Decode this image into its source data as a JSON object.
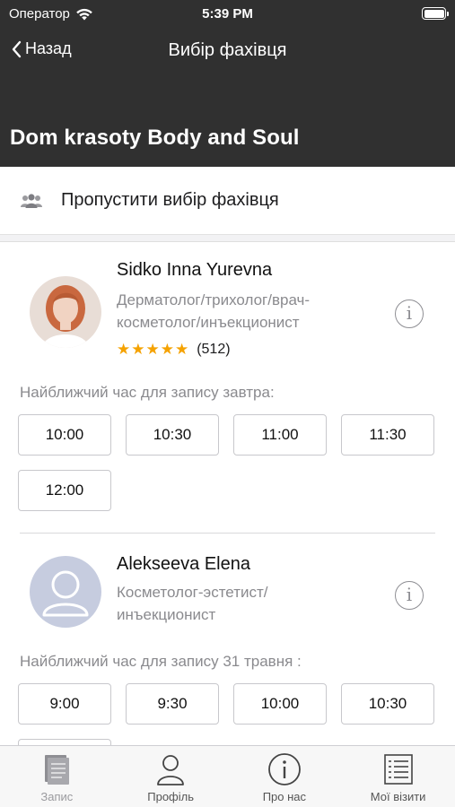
{
  "status_bar": {
    "carrier": "Оператор",
    "time": "5:39 PM"
  },
  "nav": {
    "back_label": "Назад",
    "title": "Вибір фахівця"
  },
  "salon": {
    "name": "Dom krasoty Body and Soul"
  },
  "skip": {
    "label": "Пропустити вибір фахівця",
    "icon": "group-icon"
  },
  "specialists": [
    {
      "name": "Sidko Inna Yurevna",
      "role_line1": "Дерматолог/трихолог/врач-",
      "role_line2": "косметолог/инъекционист",
      "rating_stars": "★★★★★",
      "rating_value": 5,
      "reviews": "(512)",
      "slots_caption": "Найближчий час для запису завтра:",
      "slots": [
        "10:00",
        "10:30",
        "11:00",
        "11:30",
        "12:00"
      ]
    },
    {
      "name": "Alekseeva Elena",
      "role_line1": "Косметолог-эстетист/",
      "role_line2": "инъекционист",
      "slots_caption": "Найближчий час для запису 31 травня :",
      "slots": [
        "9:00",
        "9:30",
        "10:00",
        "10:30"
      ]
    }
  ],
  "info_icon_glyph": "i",
  "tabs": [
    {
      "label": "Запис",
      "icon": "book-icon",
      "active": true
    },
    {
      "label": "Профіль",
      "icon": "person-icon",
      "active": false
    },
    {
      "label": "Про нас",
      "icon": "info-icon",
      "active": false
    },
    {
      "label": "Мої візити",
      "icon": "list-icon",
      "active": false
    }
  ],
  "colors": {
    "header_bg": "#303030",
    "star": "#f5a200",
    "muted_text": "#8a8a8e"
  }
}
